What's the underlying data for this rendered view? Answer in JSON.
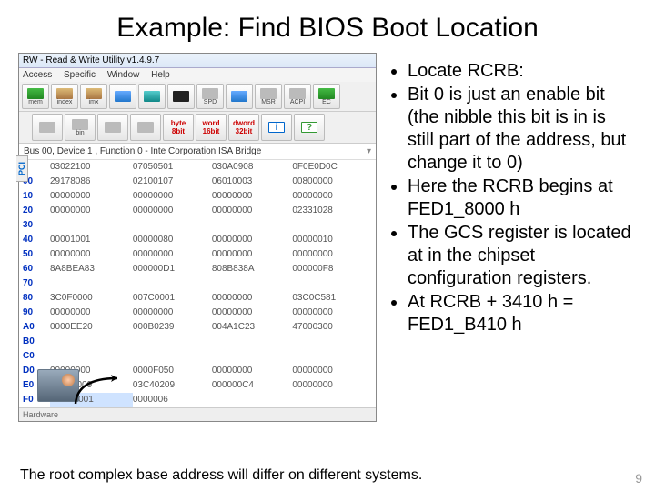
{
  "title": "Example: Find BIOS Boot Location",
  "window": {
    "titlebar": "RW - Read & Write Utility v1.4.9.7",
    "menu": {
      "access": "Access",
      "specific": "Specific",
      "window": "Window",
      "help": "Help"
    },
    "sidetab": "PCI",
    "crumb": "Bus 00, Device 1 , Function 0 - Inte Corporation ISA Bridge",
    "status": "Hardware"
  },
  "toolbar1": {
    "mem": "mem",
    "index": "index",
    "imx": "imx",
    "b5": "",
    "b6": "",
    "spd": "SPD",
    "b8": "",
    "msr": "MSR",
    "acpi": "ACPI",
    "ec": "EC"
  },
  "toolbar2": {
    "open": "",
    "save": "bin",
    "hex": "",
    "find": "",
    "b8": "byte",
    "b8l": "8bit",
    "b16": "word",
    "b16l": "16bit",
    "b32": "dword",
    "b32l": "32bit",
    "info": "i",
    "help": "?"
  },
  "rows": [
    {
      "off": "0",
      "c1": "03022100",
      "c2": "07050501",
      "c3": "030A0908",
      "c4": "0F0E0D0C"
    },
    {
      "off": "00",
      "c1": "29178086",
      "c2": "02100107",
      "c3": "06010003",
      "c4": "00800000"
    },
    {
      "off": "10",
      "c1": "00000000",
      "c2": "00000000",
      "c3": "00000000",
      "c4": "00000000"
    },
    {
      "off": "20",
      "c1": "00000000",
      "c2": "00000000",
      "c3": "00000000",
      "c4": "02331028"
    },
    {
      "off": "30",
      "c1": "",
      "c2": "",
      "c3": "",
      "c4": ""
    },
    {
      "off": "40",
      "c1": "00001001",
      "c2": "00000080",
      "c3": "00000000",
      "c4": "00000010"
    },
    {
      "off": "50",
      "c1": "00000000",
      "c2": "00000000",
      "c3": "00000000",
      "c4": "00000000"
    },
    {
      "off": "60",
      "c1": "8A8BEA83",
      "c2": "000000D1",
      "c3": "808B838A",
      "c4": "000000F8"
    },
    {
      "off": "70",
      "c1": "",
      "c2": "",
      "c3": "",
      "c4": ""
    },
    {
      "off": "80",
      "c1": "3C0F0000",
      "c2": "007C0001",
      "c3": "00000000",
      "c4": "03C0C581"
    },
    {
      "off": "90",
      "c1": "00000000",
      "c2": "00000000",
      "c3": "00000000",
      "c4": "00000000"
    },
    {
      "off": "A0",
      "c1": "0000EE20",
      "c2": "000B0239",
      "c3": "004A1C23",
      "c4": "47000300"
    },
    {
      "off": "B0",
      "c1": "",
      "c2": "",
      "c3": "",
      "c4": ""
    },
    {
      "off": "C0",
      "c1": "",
      "c2": "",
      "c3": "",
      "c4": ""
    },
    {
      "off": "D0",
      "c1": "00000000",
      "c2": "0000F050",
      "c3": "00000000",
      "c4": "00000000"
    },
    {
      "off": "E0",
      "c1": "100C0009",
      "c2": "03C40209",
      "c3": "000000C4",
      "c4": "00000000"
    },
    {
      "off": "F0",
      "c1": "FED18001",
      "c2": "0000006",
      "c3": "",
      "c4": ""
    }
  ],
  "highlight_row": 16,
  "bullets": [
    "Locate RCRB:",
    "Bit 0 is just an enable bit (the nibble this bit is in is still part of the address, but change it to 0)",
    "Here the RCRB begins at FED1_8000 h",
    "The GCS register is located at in the chipset configuration registers.",
    "At RCRB + 3410 h = FED1_B410 h"
  ],
  "footnote": "The root complex base address will differ on different systems.",
  "pagenum": "9"
}
